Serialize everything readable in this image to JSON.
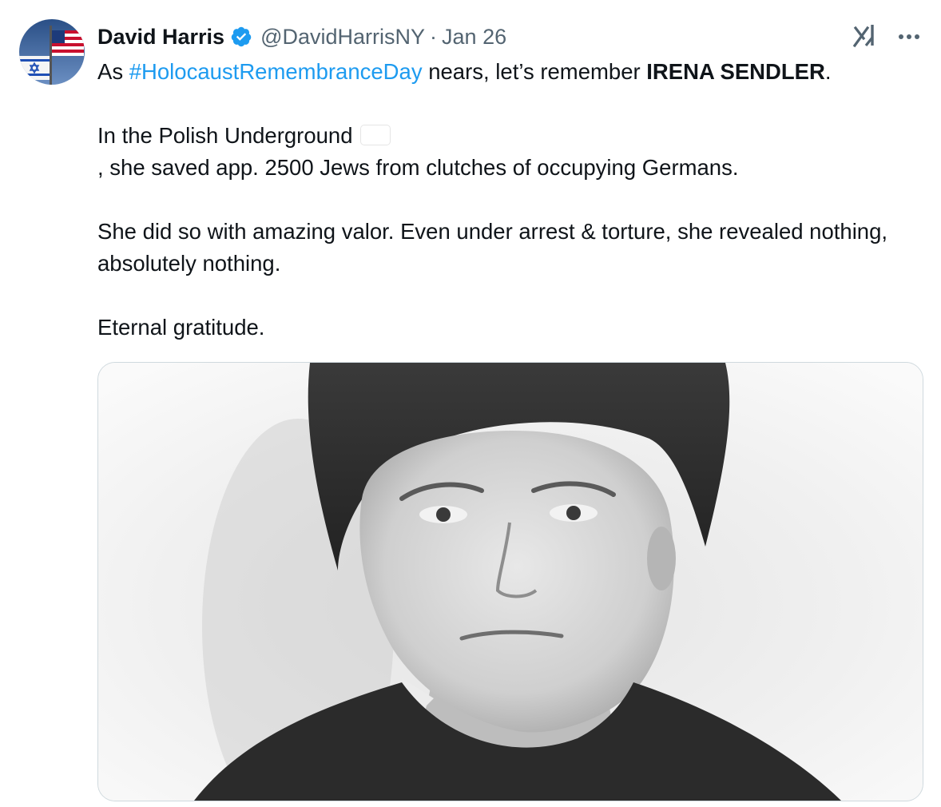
{
  "author": {
    "name": "David Harris",
    "handle": "@DavidHarrisNY",
    "separator": "·",
    "date": "Jan 26",
    "verified_color": "#1d9bf0",
    "avatar_icon": "israel-us-flags-avatar"
  },
  "tweet": {
    "line1_prefix": "As ",
    "hashtag": "#HolocaustRemembranceDay",
    "line1_middle": " nears, let’s remember ",
    "line1_bold": "IRENA SENDLER",
    "line1_suffix": ".",
    "para2_prefix": "In the Polish Underground ",
    "para2_suffix": ", she saved app. 2500 Jews from clutches of occupying Germans.",
    "para3": "She did so with amazing valor. Even under arrest & torture, she revealed nothing, absolutely nothing.",
    "para4": "Eternal gratitude."
  },
  "icons": {
    "grok": "grok-icon",
    "more": "more-options-icon",
    "flag": "poland-flag-emoji"
  },
  "colors": {
    "text": "#0f1419",
    "secondary": "#536471",
    "link": "#1d9bf0"
  }
}
